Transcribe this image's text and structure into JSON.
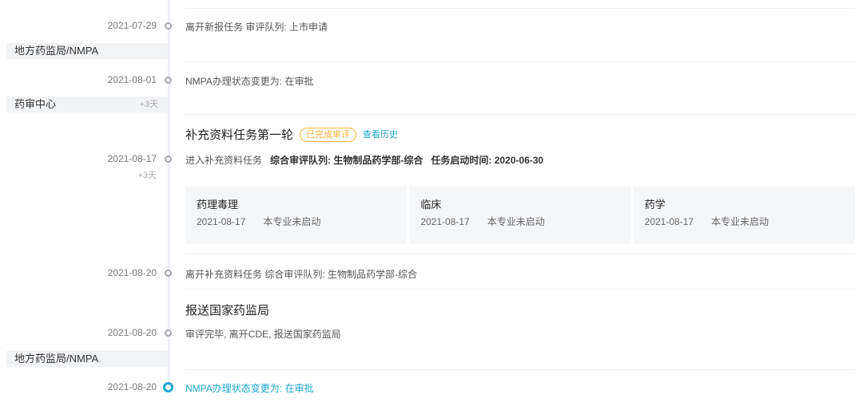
{
  "timeline": {
    "entries": [
      {
        "date": "2021-07-29",
        "text": "离开新报任务  审评队列: 上市申请"
      },
      {
        "date": "2021-08-01",
        "text": "NMPA办理状态变更为: 在审批"
      },
      {
        "date": "2021-08-17",
        "delta": "+3天",
        "text_prefix": "进入补充资料任务",
        "queue": "综合审评队列: 生物制品药学部-综合",
        "start": "任务启动时间: 2020-06-30"
      },
      {
        "date": "2021-08-20",
        "text": "离开补充资料任务  综合审评队列: 生物制品药学部-综合"
      },
      {
        "date": "2021-08-20",
        "text": "审评完毕, 离开CDE, 报送国家药监局"
      },
      {
        "date": "2021-08-20",
        "text": "NMPA办理状态变更为: 在审批"
      }
    ],
    "bands": [
      {
        "label": "地方药监局/NMPA"
      },
      {
        "label": "药审中心",
        "delta": "+3天"
      },
      {
        "label": "地方药监局/NMPA"
      }
    ],
    "sections": {
      "supplement": {
        "title": "补充资料任务第一轮",
        "badge": "已完成审评",
        "history_link": "查看历史",
        "cards": [
          {
            "title": "药理毒理",
            "date": "2021-08-17",
            "status": "本专业未启动"
          },
          {
            "title": "临床",
            "date": "2021-08-17",
            "status": "本专业未启动"
          },
          {
            "title": "药学",
            "date": "2021-08-17",
            "status": "本专业未启动"
          }
        ]
      },
      "submit": {
        "title": "报送国家药监局"
      }
    }
  },
  "colors": {
    "accent": "#1aa7cf",
    "badge": "#f2b23a",
    "band_bg": "#f2f3f5",
    "dot": "#a3a6ad"
  }
}
